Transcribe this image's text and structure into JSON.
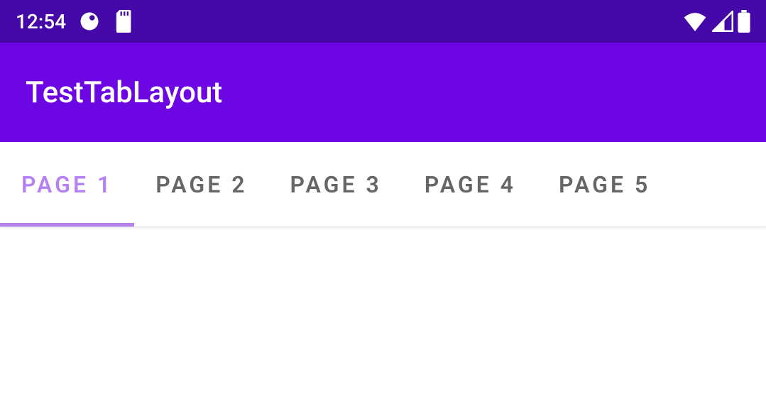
{
  "statusBar": {
    "time": "12:54"
  },
  "appBar": {
    "title": "TestTabLayout"
  },
  "tabs": [
    {
      "label": "PAGE 1",
      "active": true
    },
    {
      "label": "PAGE 2",
      "active": false
    },
    {
      "label": "PAGE 3",
      "active": false
    },
    {
      "label": "PAGE 4",
      "active": false
    },
    {
      "label": "PAGE 5",
      "active": false
    }
  ],
  "colors": {
    "statusBar": "#4508a8",
    "appBar": "#6c07e3",
    "tabActive": "#b682f3",
    "tabInactive": "#666666"
  }
}
